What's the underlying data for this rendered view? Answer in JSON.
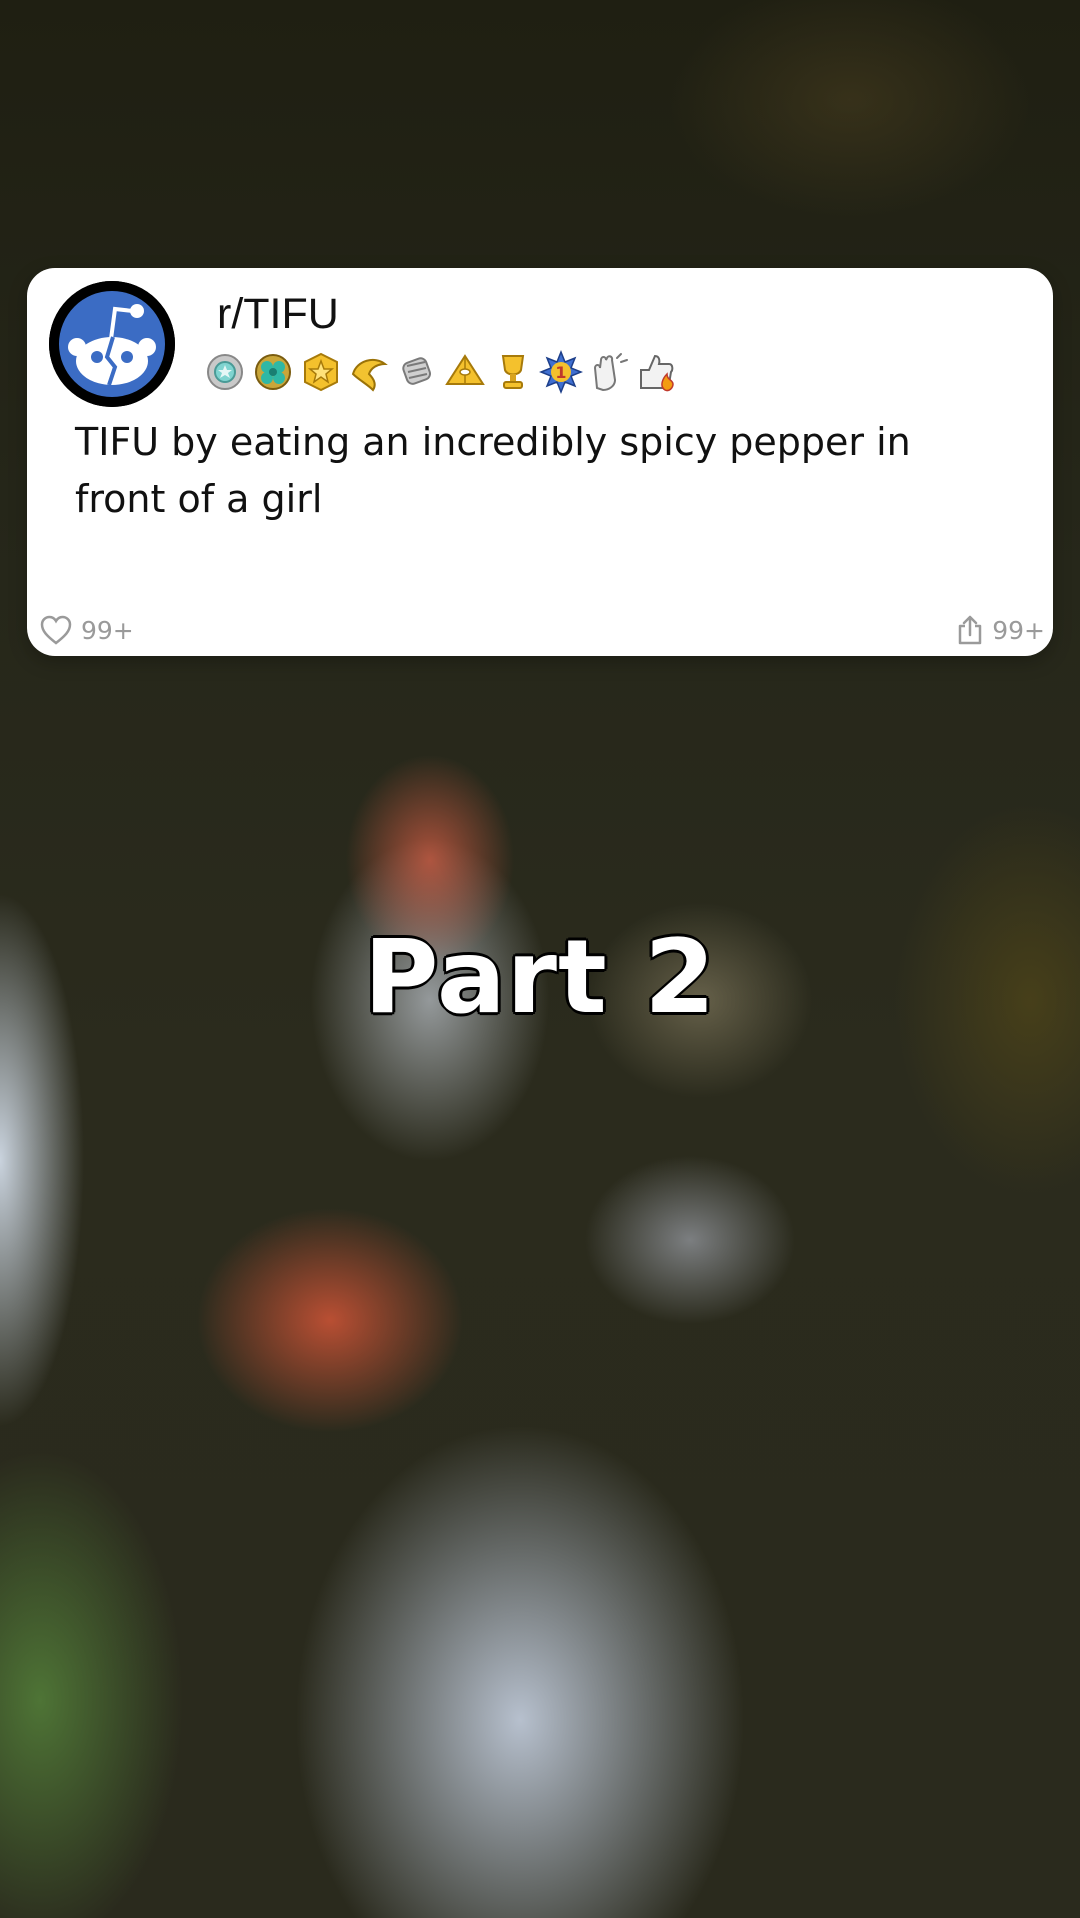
{
  "post": {
    "subreddit": "r/TIFU",
    "title": "TIFU by eating an incredibly spicy pepper in front of a girl",
    "like_count": "99+",
    "share_count": "99+",
    "awards": [
      "silver-medal-icon",
      "green-clover-award-icon",
      "gold-star-badge-icon",
      "gold-hand-award-icon",
      "silver-fist-award-icon",
      "gold-pyramid-award-icon",
      "gold-trophy-award-icon",
      "number-one-burst-award-icon",
      "clapping-hands-award-icon",
      "thumbs-up-fire-award-icon"
    ]
  },
  "overlay": {
    "part_label": "Part 2"
  },
  "colors": {
    "reddit_blue": "#3b6cc4",
    "card_bg": "#ffffff",
    "meta_gray": "#9a9a9a"
  }
}
